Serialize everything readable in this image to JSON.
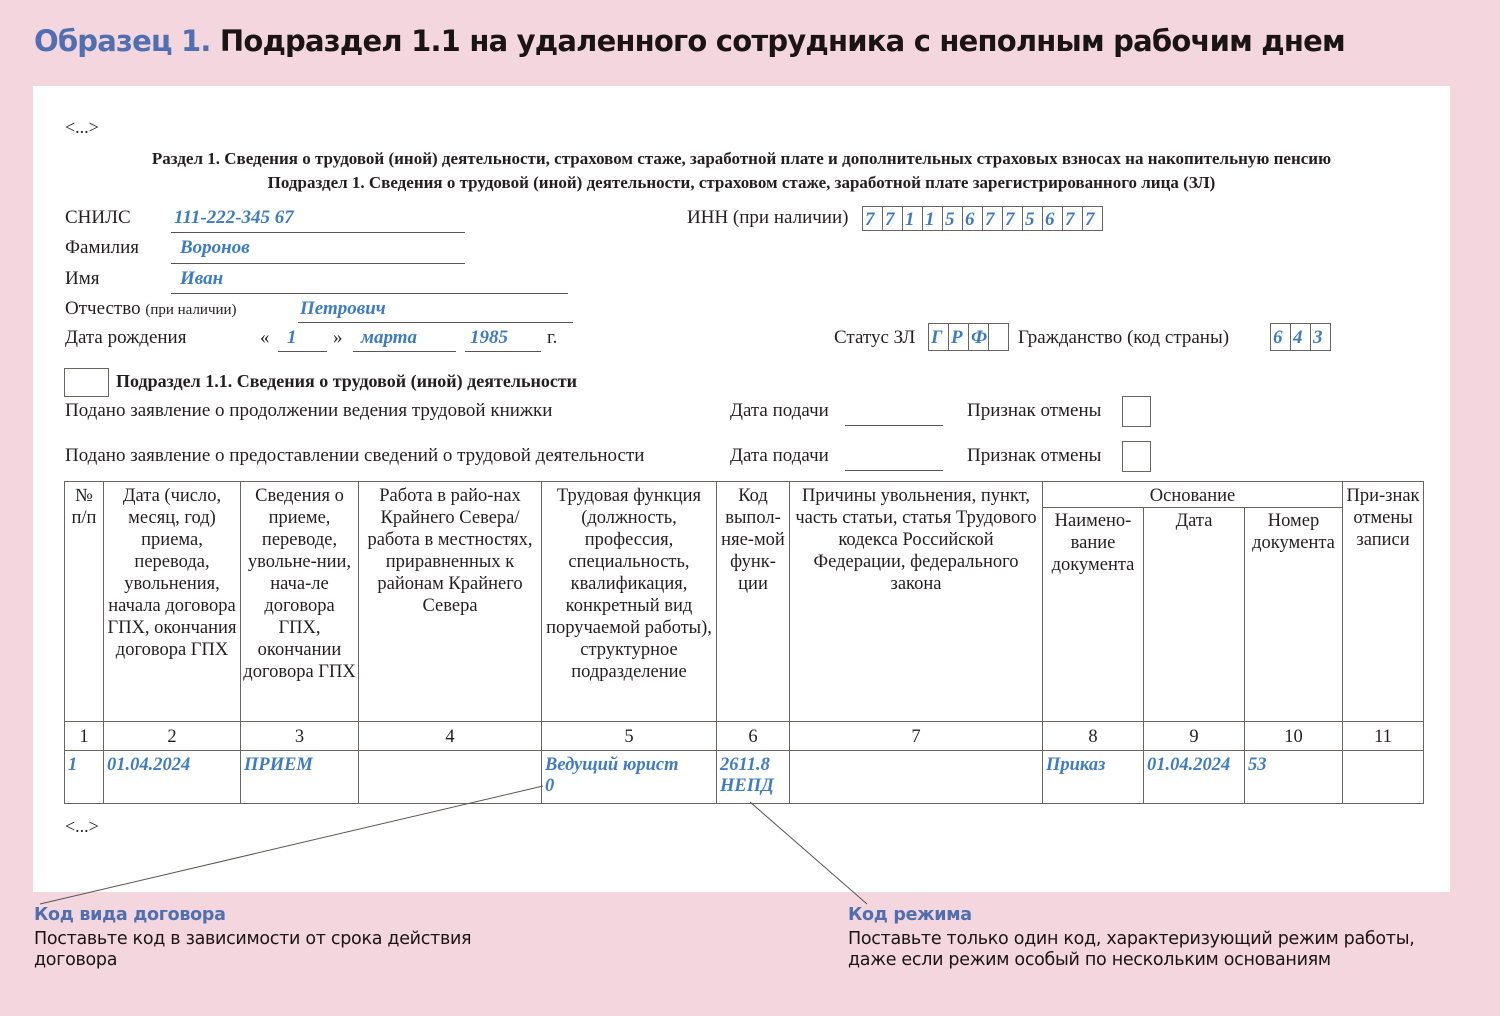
{
  "header": {
    "title_accent": "Образец 1.",
    "title_main": "Подраздел 1.1 на удаленного сотрудника с неполным рабочим днем"
  },
  "form": {
    "ellipsis_top": "<...>",
    "ellipsis_bottom": "<...>",
    "section_title": "Раздел 1. Сведения о трудовой (иной) деятельности, страховом стаже, заработной плате и дополнительных страховых взносах на накопительную пенсию",
    "subsection_title": "Подраздел 1. Сведения о трудовой (иной) деятельности, страховом стаже, заработной плате зарегистрированного лица (ЗЛ)",
    "snils": {
      "label": "СНИЛС",
      "value": "111-222-345 67"
    },
    "surname": {
      "label": "Фамилия",
      "value": "Воронов"
    },
    "name": {
      "label": "Имя",
      "value": "Иван"
    },
    "patronymic": {
      "label": "Отчество",
      "label_note": "(при наличии)",
      "value": "Петрович"
    },
    "birth_date": {
      "label": "Дата рождения",
      "open_quote": "«",
      "close_quote": "»",
      "day": "1",
      "month": "марта",
      "year": "1985",
      "year_suffix": "г."
    },
    "inn": {
      "label": "ИНН (при наличии)",
      "digits": [
        "7",
        "7",
        "1",
        "1",
        "5",
        "6",
        "7",
        "7",
        "5",
        "6",
        "7",
        "7"
      ]
    },
    "status": {
      "label": "Статус ЗЛ",
      "cells": [
        "Г",
        "Р",
        "Ф",
        ""
      ]
    },
    "citizenship": {
      "label": "Гражданство (код страны)",
      "cells": [
        "6",
        "4",
        "3"
      ]
    },
    "subsection_1_1": {
      "title": "Подраздел 1.1. Сведения о трудовой (иной) деятельности",
      "rows": [
        {
          "label": "Подано заявление о продолжении ведения трудовой книжки",
          "date_label": "Дата подачи",
          "date_value": "",
          "cancel_label": "Признак отмены",
          "cancel_value": ""
        },
        {
          "label": "Подано заявление о предоставлении сведений о трудовой деятельности",
          "date_label": "Дата подачи",
          "date_value": "",
          "cancel_label": "Признак отмены",
          "cancel_value": ""
        }
      ]
    },
    "table": {
      "headers": {
        "c1": "№ п/п",
        "c2": "Дата (число, месяц, год) приема, перевода, увольнения, начала договора ГПХ, окончания договора ГПХ",
        "c3": "Сведения о приеме, переводе, увольне-нии, нача-ле договора ГПХ, окончании договора ГПХ",
        "c4": "Работа в райо-нах Крайнего Севера/работа в местностях, приравненных к районам Крайнего Севера",
        "c5": "Трудовая функция (должность, профессия, специальность, квалификация, конкретный вид поручаемой работы), структурное подразделение",
        "c6": "Код выпол-няе-мой функ-ции",
        "c7": "Причины увольнения, пункт, часть статьи, статья Трудового кодекса Российской Федерации, федерального закона",
        "group_basis": "Основание",
        "c8": "Наимено-вание документа",
        "c9": "Дата",
        "c10": "Номер документа",
        "c11": "При-знак отмены записи"
      },
      "column_numbers": [
        "1",
        "2",
        "3",
        "4",
        "5",
        "6",
        "7",
        "8",
        "9",
        "10",
        "11"
      ],
      "rows": [
        {
          "c1": "1",
          "c2": "01.04.2024",
          "c3": "ПРИЕМ",
          "c4": "",
          "c5_line1": "Ведущий юрист",
          "c5_line2": "0",
          "c6_line1": "2611.8",
          "c6_line2": "НЕПД",
          "c7": "",
          "c8": "Приказ",
          "c9": "01.04.2024",
          "c10": "53",
          "c11": ""
        }
      ]
    }
  },
  "notes": [
    {
      "title": "Код вида договора",
      "text_line1": "Поставьте код в зависимости от срока действия",
      "text_line2": "договора"
    },
    {
      "title": "Код режима",
      "text_line1": "Поставьте только один код, характеризующий режим работы,",
      "text_line2": "даже если режим особый по нескольким основаниям"
    }
  ],
  "colors": {
    "background": "#f4d6df",
    "accent_blue": "#4f6fb0",
    "filled_value_blue": "#3d7cc4"
  }
}
